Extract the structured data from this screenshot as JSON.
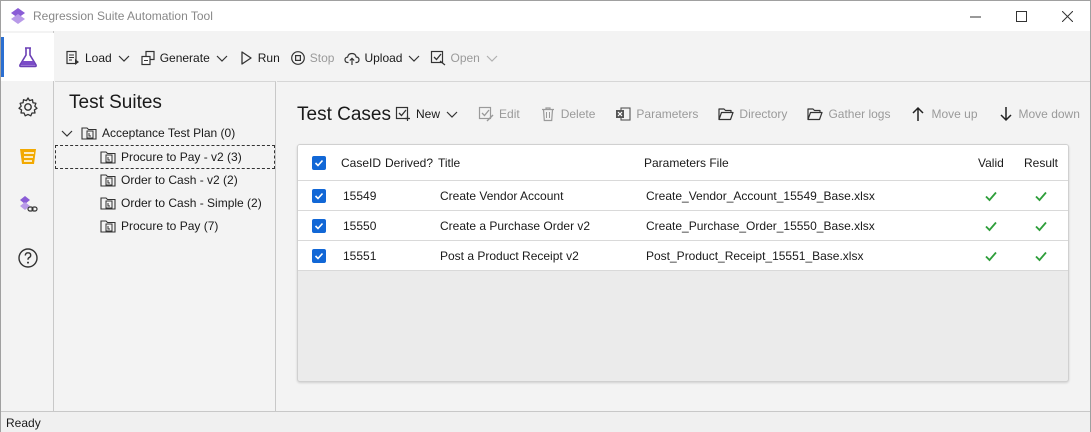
{
  "window": {
    "title": "Regression Suite Automation Tool",
    "accent": "#2b6fd1"
  },
  "sidebar_icons": [
    {
      "name": "flask-icon",
      "active": true
    },
    {
      "name": "gear-icon",
      "active": false
    },
    {
      "name": "board-icon",
      "active": false
    },
    {
      "name": "link-icon",
      "active": false
    },
    {
      "name": "help-icon",
      "active": false
    }
  ],
  "toolbar": {
    "load": "Load",
    "generate": "Generate",
    "run": "Run",
    "stop": "Stop",
    "upload": "Upload",
    "open": "Open"
  },
  "suites": {
    "heading": "Test Suites",
    "root": "Acceptance Test Plan (0)",
    "items": [
      "Procure to Pay - v2 (3)",
      "Order to Cash - v2 (2)",
      "Order to Cash - Simple (2)",
      "Procure to Pay (7)"
    ]
  },
  "cases": {
    "heading": "Test Cases",
    "toolbar": {
      "new": "New",
      "edit": "Edit",
      "delete": "Delete",
      "parameters": "Parameters",
      "directory": "Directory",
      "gather_logs": "Gather logs",
      "move_up": "Move up",
      "move_down": "Move down"
    },
    "columns": {
      "caseid": "CaseID",
      "derived": "Derived?",
      "title": "Title",
      "params": "Parameters File",
      "valid": "Valid",
      "result": "Result"
    },
    "rows": [
      {
        "caseid": "15549",
        "title": "Create Vendor Account",
        "params": "Create_Vendor_Account_15549_Base.xlsx",
        "checked": true,
        "valid": true,
        "result": true
      },
      {
        "caseid": "15550",
        "title": "Create a Purchase Order v2",
        "params": "Create_Purchase_Order_15550_Base.xlsx",
        "checked": true,
        "valid": true,
        "result": true
      },
      {
        "caseid": "15551",
        "title": "Post a Product Receipt v2",
        "params": "Post_Product_Receipt_15551_Base.xlsx",
        "checked": true,
        "valid": true,
        "result": true
      }
    ]
  },
  "status": {
    "text": "Ready"
  },
  "colors": {
    "checkbox": "#1167d6",
    "success": "#2e9e3a"
  }
}
